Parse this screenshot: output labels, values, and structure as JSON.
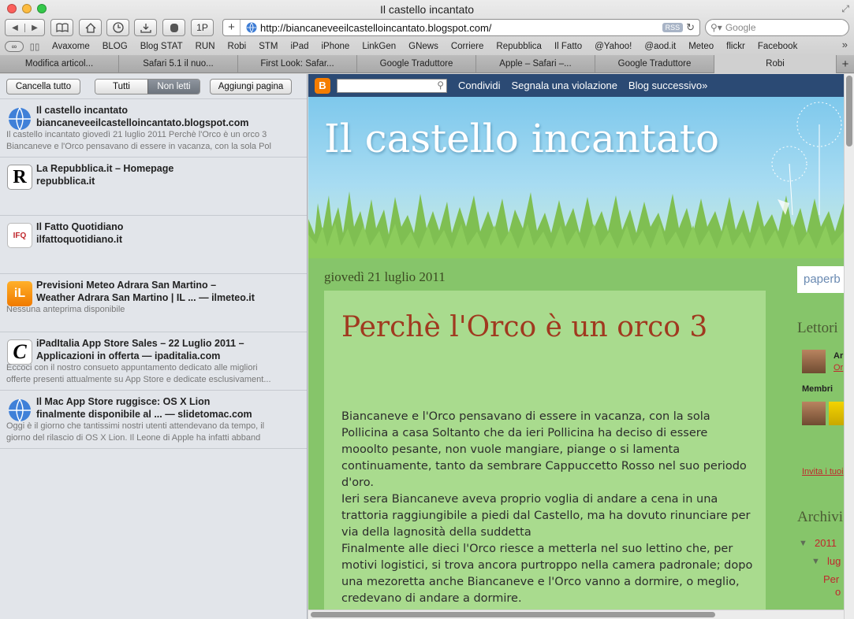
{
  "window": {
    "title": "Il castello incantato"
  },
  "toolbar": {
    "back_icon": "back-arrow-icon",
    "forward_icon": "forward-arrow-icon",
    "top_sites_label": "1P",
    "url": "http://biancaneveeilcastelloincantato.blogspot.com/",
    "rss_label": "RSS",
    "search_placeholder": "Google"
  },
  "bookmarks": [
    "Avaxome",
    "BLOG",
    "Blog STAT",
    "RUN",
    "Robi",
    "STM",
    "iPad",
    "iPhone",
    "LinkGen",
    "GNews",
    "Corriere",
    "Repubblica",
    "Il Fatto",
    "@Yahoo!",
    "@aod.it",
    "Meteo",
    "flickr",
    "Facebook"
  ],
  "tabs": [
    "Modifica articol...",
    "Safari 5.1 il nuo...",
    "First Look: Safar...",
    "Google Traduttore",
    "Apple – Safari –...",
    "Google Traduttore",
    "Robi"
  ],
  "reading_list": {
    "clear_all": "Cancella tutto",
    "filter_all": "Tutti",
    "filter_unread": "Non letti",
    "add_page": "Aggiungi pagina",
    "items": [
      {
        "title": "Il castello incantato",
        "subtitle": "biancaneveeilcastelloincantato.blogspot.com",
        "preview1": "Il castello incantato giovedì 21 luglio 2011 Perchè l'Orco è un orco 3",
        "preview2": "Biancaneve e l'Orco pensavano di essere in vacanza, con la sola Pol",
        "icon": "globe-icon"
      },
      {
        "title": "La Repubblica.it – Homepage",
        "subtitle": "repubblica.it",
        "preview1": "",
        "preview2": "",
        "icon": "repubblica-icon",
        "icon_text": "R"
      },
      {
        "title": "Il Fatto Quotidiano",
        "subtitle": "ilfattoquotidiano.it",
        "preview1": "",
        "preview2": "",
        "icon": "ilfatto-icon",
        "icon_text": "IFQ"
      },
      {
        "title": "Previsioni Meteo Adrara San Martino –",
        "subtitle": "Weather Adrara San Martino | IL ... — ilmeteo.it",
        "preview1": "Nessuna anteprima disponibile",
        "preview2": "",
        "icon": "ilmeteo-icon",
        "icon_text": "iL"
      },
      {
        "title": "iPadItalia App Store Sales – 22 Luglio 2011 –",
        "subtitle": "Applicazioni in offerta — ipaditalia.com",
        "preview1": "Eccoci con il nostro consueto appuntamento dedicato alle migliori",
        "preview2": "offerte presenti attualmente su App Store e dedicate esclusivament...",
        "icon": "ipaditalia-icon",
        "icon_text": "C"
      },
      {
        "title": "Il Mac App Store ruggisce: OS X Lion",
        "subtitle": "finalmente disponibile al ... — slidetomac.com",
        "preview1": "Oggi è il giorno che tantissimi nostri utenti attendevano da tempo, il",
        "preview2": "giorno del rilascio di OS X Lion. Il Leone di Apple ha infatti abband",
        "icon": "globe-icon"
      }
    ]
  },
  "blogger_bar": {
    "share": "Condividi",
    "report": "Segnala una violazione",
    "next": "Blog successivo»"
  },
  "blog": {
    "title": "Il castello incantato",
    "date": "giovedì 21 luglio 2011",
    "post_title": "Perchè l'Orco è un orco 3",
    "paragraphs": [
      "Biancaneve e l'Orco pensavano di essere in vacanza, con la sola Pollicina a casa Soltanto che da ieri Pollicina ha deciso di essere mooolto pesante, non vuole mangiare, piange o si lamenta continuamente, tanto da sembrare Cappuccetto Rosso nel suo periodo d'oro.",
      "Ieri sera Biancaneve aveva proprio voglia di andare a cena in una trattoria raggiungibile a piedi dal Castello, ma ha dovuto rinunciare per via della lagnosità della suddetta",
      "Finalmente alle dieci l'Orco riesce a metterla nel suo lettino che, per motivi logistici, si trova ancora purtroppo nella camera padronale; dopo una mezoretta anche Biancaneve e l'Orco vanno a dormire, o meglio, credevano di andare a dormire."
    ]
  },
  "sidebar_right": {
    "paper_label": "paperb",
    "readers_head": "Lettori",
    "reader_initial": "Ar",
    "reader_link": "Or",
    "members_label": "Membri",
    "invite": "Invita i tuoi",
    "archive_head": "Archivi",
    "year": "2011",
    "month": "lug",
    "post_short": "Per",
    "post_short2": "o"
  }
}
